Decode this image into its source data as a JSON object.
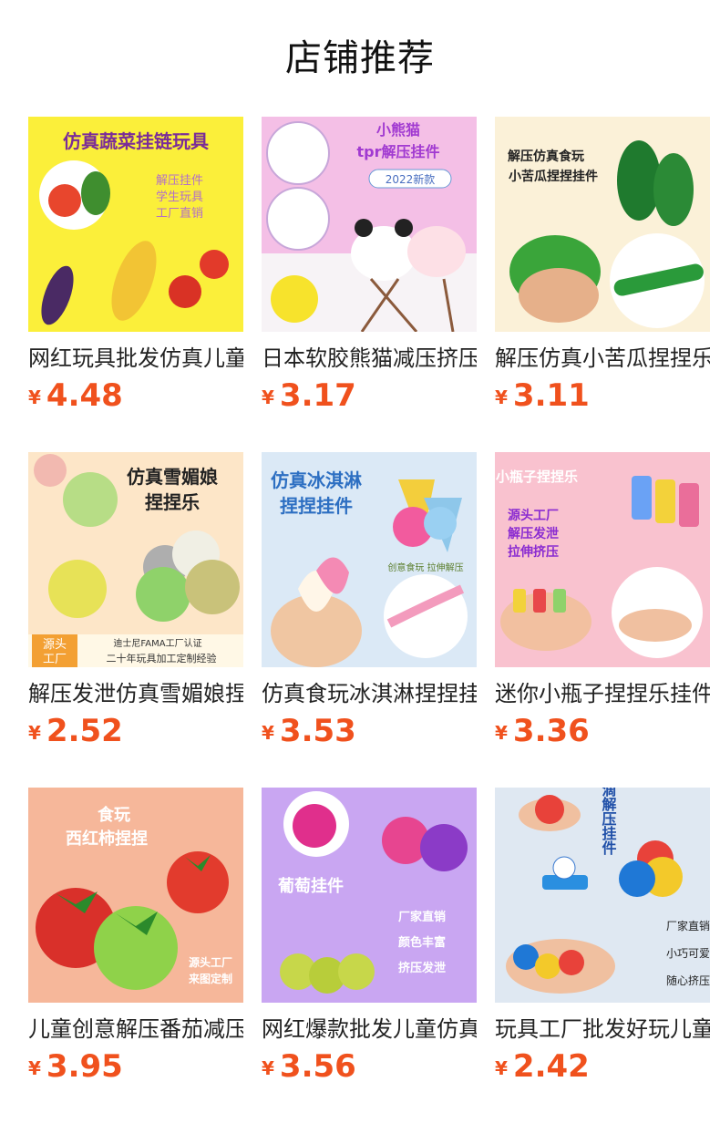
{
  "header": {
    "title": "店铺推荐"
  },
  "currency_symbol": "¥",
  "products": [
    {
      "title": "网红玩具批发仿真儿童",
      "price": "4.48",
      "image_text": [
        "仿真蔬菜挂链玩具",
        "解压挂件",
        "学生玩具",
        "工厂直销"
      ]
    },
    {
      "title": "日本软胶熊猫减压挤压",
      "price": "3.17",
      "image_text": [
        "小熊猫",
        "tpr解压挂件",
        "2022新款"
      ]
    },
    {
      "title": "解压仿真小苦瓜捏捏乐",
      "price": "3.11",
      "image_text": [
        "解压仿真食玩",
        "小苦瓜捏捏挂件"
      ]
    },
    {
      "title": "解压发泄仿真雪媚娘捏",
      "price": "2.52",
      "image_text": [
        "仿真雪媚娘",
        "捏捏乐",
        "源头",
        "工厂",
        "迪士尼FAMA工厂认证",
        "二十年玩具加工定制经验"
      ]
    },
    {
      "title": "仿真食玩冰淇淋捏捏挂",
      "price": "3.53",
      "image_text": [
        "仿真冰淇淋",
        "捏捏挂件",
        "创意食玩 拉伸解压"
      ]
    },
    {
      "title": "迷你小瓶子捏捏乐挂件",
      "price": "3.36",
      "image_text": [
        "小瓶子捏捏乐",
        "源头工厂",
        "解压发泄",
        "拉伸挤压"
      ]
    },
    {
      "title": "儿童创意解压番茄减压",
      "price": "3.95",
      "image_text": [
        "食玩",
        "西红柿捏捏",
        "源头工厂",
        "来图定制"
      ]
    },
    {
      "title": "网红爆款批发儿童仿真",
      "price": "3.56",
      "image_text": [
        "葡萄挂件",
        "厂家直销",
        "颜色丰富",
        "挤压发泄"
      ]
    },
    {
      "title": "玩具工厂批发好玩儿童",
      "price": "2.42",
      "image_text": [
        "小水滴解压挂件",
        "厂家直销",
        "小巧可爱",
        "随心挤压"
      ]
    }
  ]
}
